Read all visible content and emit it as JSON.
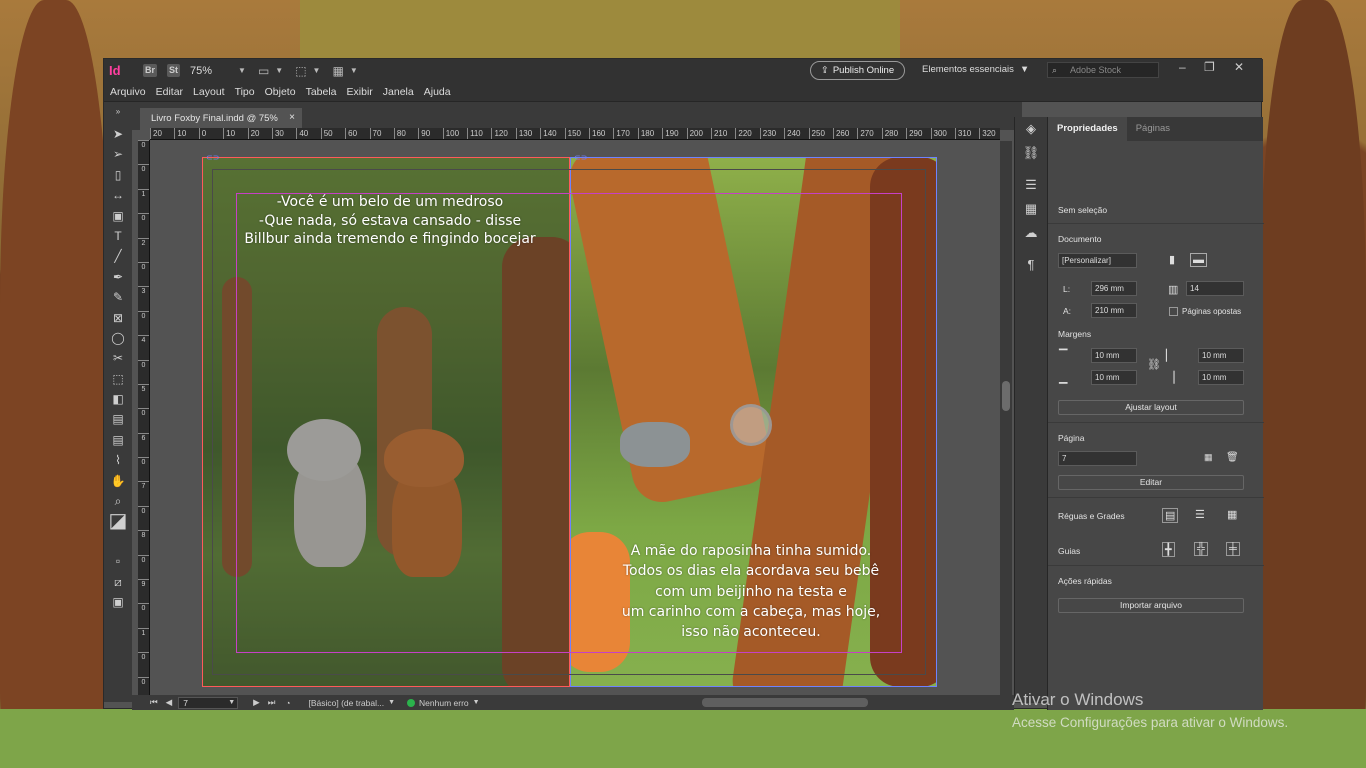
{
  "app": {
    "logo": "Id",
    "bridge": "Br",
    "stock_mini": "St",
    "zoom": "75%",
    "publish": "Publish Online",
    "workspace": "Elementos essenciais",
    "stock_placeholder": "Adobe Stock"
  },
  "menu": [
    "Arquivo",
    "Editar",
    "Layout",
    "Tipo",
    "Objeto",
    "Tabela",
    "Exibir",
    "Janela",
    "Ajuda"
  ],
  "doc_tab": {
    "title": "Livro Foxby Final.indd @ 75%",
    "close": "×"
  },
  "ruler_h": [
    "20",
    "10",
    "0",
    "10",
    "20",
    "30",
    "40",
    "50",
    "60",
    "70",
    "80",
    "90",
    "100",
    "110",
    "120",
    "130",
    "140",
    "150",
    "160",
    "170",
    "180",
    "190",
    "200",
    "210",
    "220",
    "230",
    "240",
    "250",
    "260",
    "270",
    "280",
    "290",
    "300",
    "310",
    "320"
  ],
  "ruler_v": [
    "0",
    "0",
    "1",
    "0",
    "2",
    "0",
    "3",
    "0",
    "4",
    "0",
    "5",
    "0",
    "6",
    "0",
    "7",
    "0",
    "8",
    "0",
    "9",
    "0",
    "1",
    "0",
    "0",
    "1",
    "1",
    "0"
  ],
  "story": {
    "left_lines": [
      "-Você é um belo de um medroso",
      "-Que nada, só estava cansado - disse",
      "Billbur ainda tremendo e fingindo bocejar"
    ],
    "right_lines": [
      "A mãe do raposinha tinha sumido.",
      "Todos os dias ela acordava seu bebê",
      "com um beijinho na testa e",
      "um carinho com a cabeça, mas hoje,",
      "isso não aconteceu."
    ]
  },
  "status": {
    "page": "7",
    "style": "[Básico] (de trabal...",
    "errors": "Nenhum erro"
  },
  "panel": {
    "tabs": [
      "Propriedades",
      "Páginas"
    ],
    "selection": "Sem seleção",
    "document_label": "Documento",
    "preset": "[Personalizar]",
    "width_label": "L:",
    "width": "296 mm",
    "height_label": "A:",
    "height": "210 mm",
    "pages": "14",
    "facing": "Páginas opostas",
    "margins_label": "Margens",
    "margin_top": "10 mm",
    "margin_bottom": "10 mm",
    "margin_left": "10 mm",
    "margin_right": "10 mm",
    "adjust_layout": "Ajustar layout",
    "page_label": "Página",
    "page_value": "7",
    "edit": "Editar",
    "rulers_grids": "Réguas e Grades",
    "guides": "Guias",
    "quick_actions": "Ações rápidas",
    "import_file": "Importar arquivo"
  },
  "watermark": {
    "line1": "Ativar o Windows",
    "line2": "Acesse Configurações para ativar o Windows."
  },
  "colors": {
    "accent": "#ff3fa0",
    "margin_guide": "#c640c6",
    "column_guide": "#6e82ff",
    "status_ok": "#2bb24c"
  }
}
